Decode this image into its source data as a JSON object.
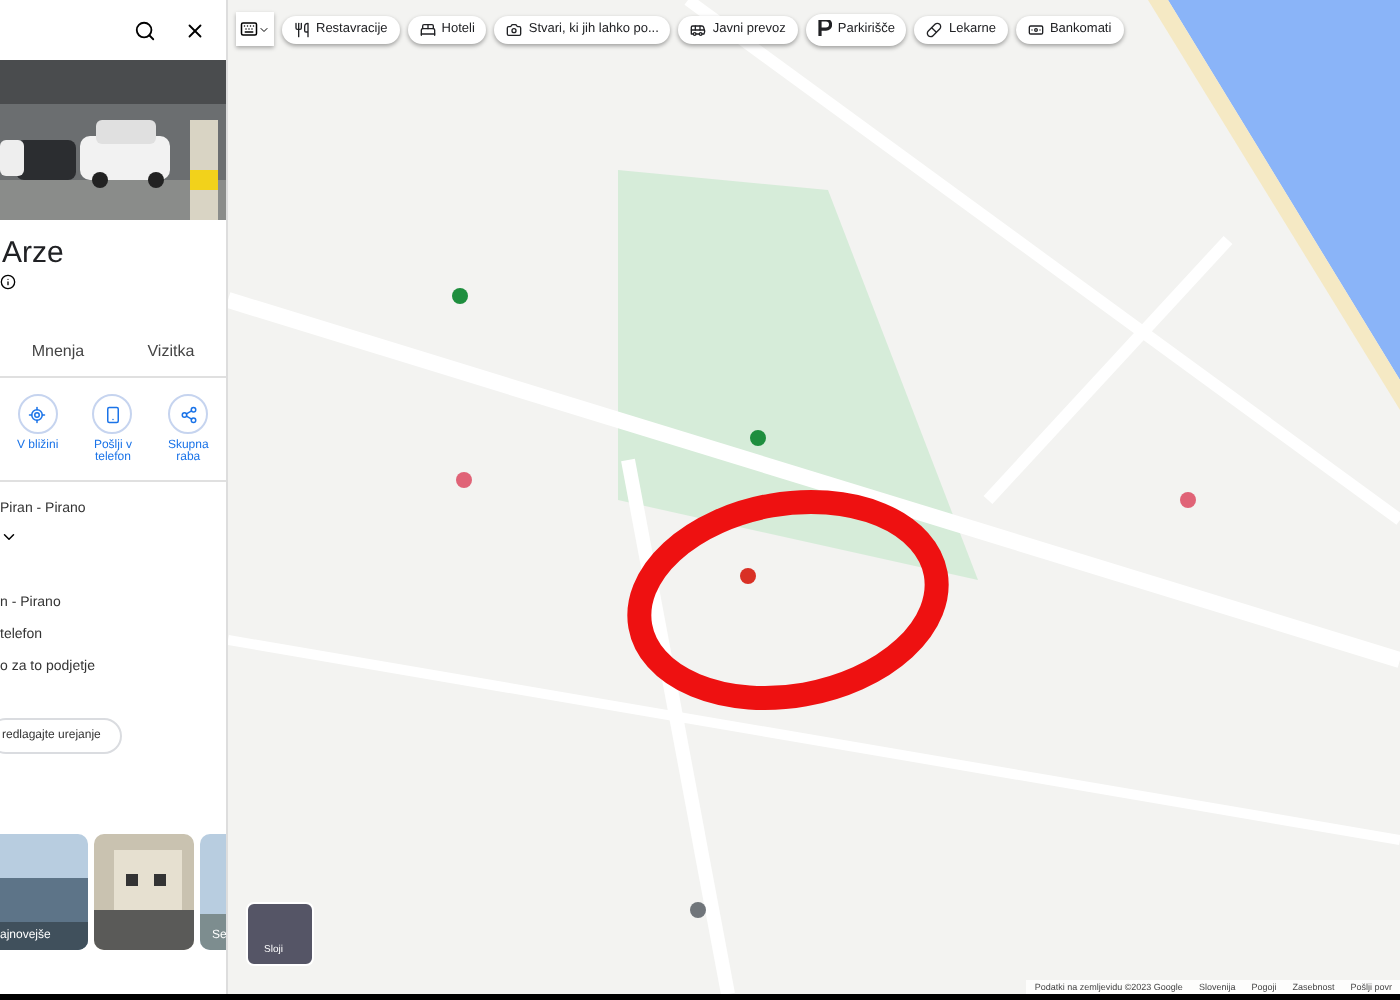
{
  "sidebar": {
    "title": "Arze",
    "tabs": [
      {
        "label": "Mnenja"
      },
      {
        "label": "Vizitka"
      }
    ],
    "actions": [
      {
        "label": "V bližini"
      },
      {
        "label": "Pošlji v telefon"
      },
      {
        "label": "Skupna raba"
      }
    ],
    "address": "Piran - Pirano",
    "details": [
      "n - Pirano",
      "telefon",
      "o za to podjetje"
    ],
    "suggest_button": "redlagajte urejanje",
    "photos": [
      {
        "kind": "picture",
        "caption": "ajnovejše"
      },
      {
        "kind": "picture"
      },
      {
        "kind": "picture",
        "caption": "Se"
      }
    ]
  },
  "chips": [
    {
      "label": "Restavracije"
    },
    {
      "label": "Hoteli"
    },
    {
      "label": "Stvari, ki jih lahko po..."
    },
    {
      "label": "Javni prevoz"
    },
    {
      "label": "Parkirišče"
    },
    {
      "label": "Lekarne"
    },
    {
      "label": "Bankomati"
    }
  ],
  "layers_button": "Sloji",
  "attribution": [
    "Podatki na zemljevidu ©2023 Google",
    "Slovenija",
    "Pogoji",
    "Zasebnost",
    "Pošlji povr"
  ]
}
